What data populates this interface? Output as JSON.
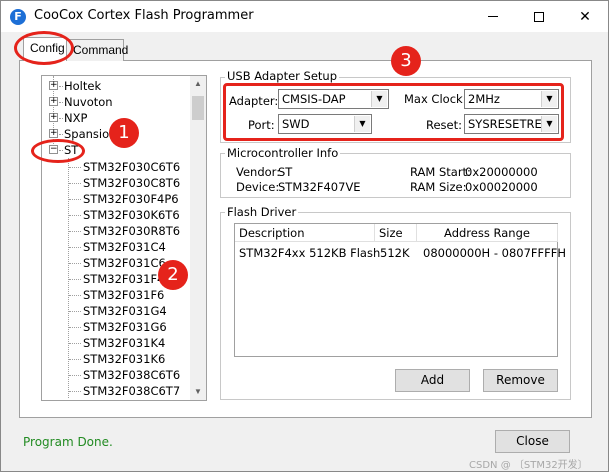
{
  "window": {
    "title": "CooCox Cortex Flash Programmer",
    "icon_letter": "F"
  },
  "tabs": [
    {
      "label": "Config",
      "active": true
    },
    {
      "label": "Command",
      "active": false
    }
  ],
  "tree": {
    "vendors": [
      {
        "label": "Holtek",
        "expanded": false
      },
      {
        "label": "Nuvoton",
        "expanded": false
      },
      {
        "label": "NXP",
        "expanded": false
      },
      {
        "label": "Spansion",
        "expanded": false
      },
      {
        "label": "ST",
        "expanded": true
      }
    ],
    "st_children": [
      "STM32F030C6T6",
      "STM32F030C8T6",
      "STM32F030F4P6",
      "STM32F030K6T6",
      "STM32F030R8T6",
      "STM32F031C4",
      "STM32F031C6",
      "STM32F031F4",
      "STM32F031F6",
      "STM32F031G4",
      "STM32F031G6",
      "STM32F031K4",
      "STM32F031K6",
      "STM32F038C6T6",
      "STM32F038C6T7"
    ]
  },
  "usb_adapter": {
    "group_title": "USB Adapter Setup",
    "adapter_label": "Adapter:",
    "adapter_value": "CMSIS-DAP",
    "max_clock_label": "Max Clock:",
    "max_clock_value": "2MHz",
    "port_label": "Port:",
    "port_value": "SWD",
    "reset_label": "Reset:",
    "reset_value": "SYSRESETREQ"
  },
  "mcu_info": {
    "group_title": "Microcontroller Info",
    "vendor_label": "Vendor:",
    "vendor_value": "ST",
    "device_label": "Device:",
    "device_value": "STM32F407VE",
    "ram_start_label": "RAM Start:",
    "ram_start_value": "0x20000000",
    "ram_size_label": "RAM Size:",
    "ram_size_value": "0x00020000"
  },
  "flash_driver": {
    "group_title": "Flash Driver",
    "columns": [
      "Description",
      "Size",
      "Address Range"
    ],
    "rows": [
      {
        "description": "STM32F4xx 512KB Flash",
        "size": "512K",
        "address_range": "08000000H - 0807FFFFH"
      }
    ],
    "add_label": "Add",
    "remove_label": "Remove"
  },
  "annotations": [
    "1",
    "2",
    "3"
  ],
  "status_text": "Program Done.",
  "close_label": "Close",
  "watermark": "CSDN @ 〔STM32开发〕",
  "colors": {
    "annotation_red": "#e5231b",
    "status_green": "#228b22",
    "app_icon_blue": "#1d6fd6"
  }
}
